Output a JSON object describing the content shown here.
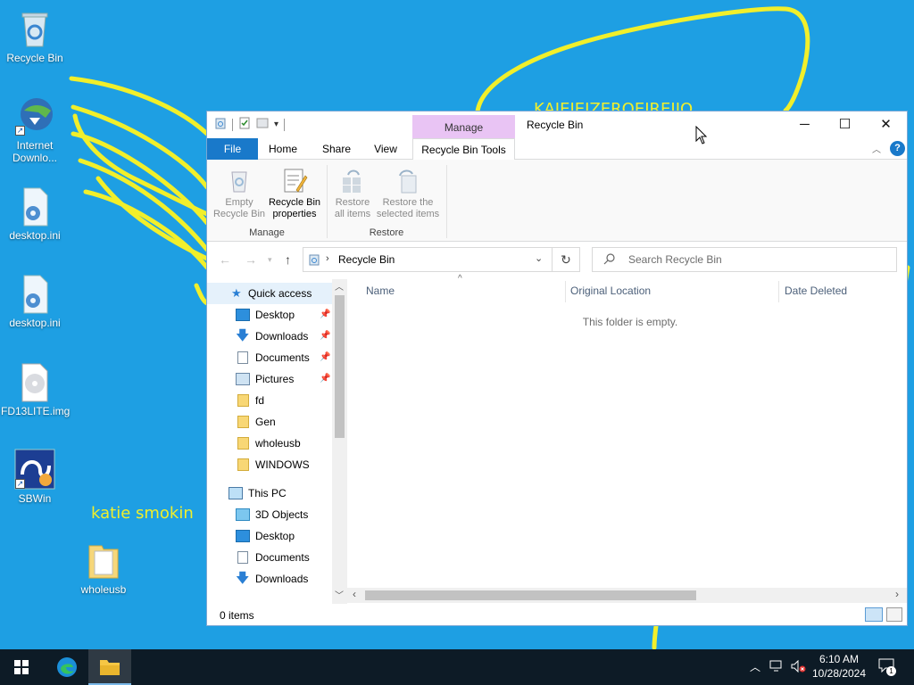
{
  "desktop": {
    "scribble_texts": [
      "KAJEIEIZEROEIREIJO",
      "katie smokin"
    ],
    "icons": [
      {
        "name": "recycle-bin",
        "label": "Recycle Bin"
      },
      {
        "name": "internet-download-manager",
        "label_line1": "Internet",
        "label_line2": "Downlo..."
      },
      {
        "name": "desktop-ini-1",
        "label": "desktop.ini"
      },
      {
        "name": "desktop-ini-2",
        "label": "desktop.ini"
      },
      {
        "name": "fd13lite-img",
        "label": "FD13LITE.img"
      },
      {
        "name": "sbwin",
        "label": "SBWin"
      },
      {
        "name": "wholeusb-folder",
        "label": "wholeusb"
      }
    ]
  },
  "window": {
    "title": "Recycle Bin",
    "context_tab": "Manage",
    "tabs": [
      "File",
      "Home",
      "Share",
      "View",
      "Recycle Bin Tools"
    ],
    "ribbon": {
      "manage_group": {
        "label": "Manage",
        "empty_line1": "Empty",
        "empty_line2": "Recycle Bin",
        "props_line1": "Recycle Bin",
        "props_line2": "properties"
      },
      "restore_group": {
        "label": "Restore",
        "restore_all_line1": "Restore",
        "restore_all_line2": "all items",
        "restore_sel_line1": "Restore the",
        "restore_sel_line2": "selected items"
      }
    },
    "address": {
      "path": "Recycle Bin",
      "search_placeholder": "Search Recycle Bin"
    },
    "nav": {
      "quick_access": "Quick access",
      "quick_items": [
        "Desktop",
        "Downloads",
        "Documents",
        "Pictures",
        "fd",
        "Gen",
        "wholeusb",
        "WINDOWS"
      ],
      "this_pc": "This PC",
      "pc_items": [
        "3D Objects",
        "Desktop",
        "Documents",
        "Downloads"
      ]
    },
    "columns": [
      "Name",
      "Original Location",
      "Date Deleted"
    ],
    "empty_message": "This folder is empty.",
    "status": "0 items"
  },
  "taskbar": {
    "time": "6:10 AM",
    "date": "10/28/2024",
    "notification_count": "1"
  },
  "colors": {
    "desktop_bg": "#1e9fe3",
    "scribble": "#f1ef2b",
    "file_tab": "#1979ca",
    "context_tab": "#e9c4f4",
    "taskbar": "#0d1b26"
  }
}
